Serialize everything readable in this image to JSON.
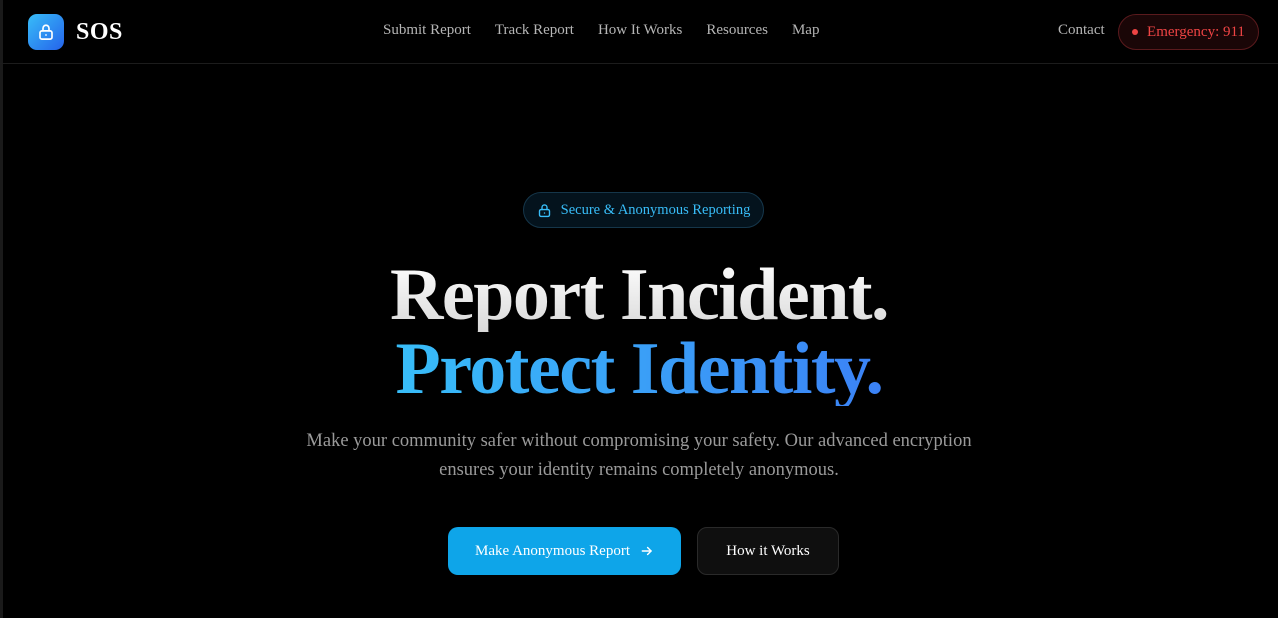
{
  "brand": {
    "name": "SOS",
    "icon": "lock-icon",
    "gradient_start": "#38bdf8",
    "gradient_end": "#2563eb"
  },
  "nav": {
    "items": [
      {
        "label": "Submit Report"
      },
      {
        "label": "Track Report"
      },
      {
        "label": "How It Works"
      },
      {
        "label": "Resources"
      },
      {
        "label": "Map"
      }
    ],
    "contact_label": "Contact",
    "emergency_label": "Emergency: 911",
    "emergency_color": "#ef4444"
  },
  "hero": {
    "badge_label": "Secure & Anonymous Reporting",
    "badge_icon": "lock-icon",
    "headline_line1": "Report Incident.",
    "headline_line2": "Protect Identity.",
    "description": "Make your community safer without compromising your safety. Our advanced encryption ensures your identity remains completely anonymous.",
    "primary_button_label": "Make Anonymous Report",
    "primary_button_icon": "arrow-right-icon",
    "secondary_button_label": "How it Works",
    "accent_color": "#0ea5e9"
  }
}
